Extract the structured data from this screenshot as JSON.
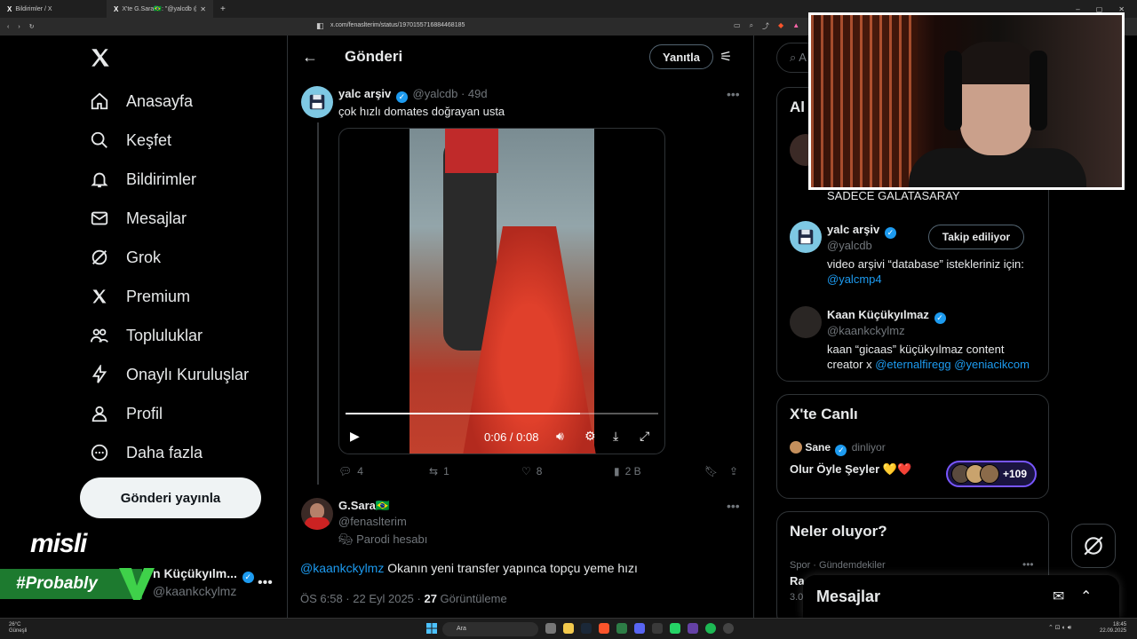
{
  "browser": {
    "tabs": [
      {
        "label": "Bildirimler / X"
      },
      {
        "label": "X'te G.Sara🇧🇷: \"@yalcdb @k..."
      }
    ],
    "url": "x.com/fenaslterim/status/1970155716884468185"
  },
  "nav": {
    "items": [
      {
        "label": "Anasayfa",
        "icon": "home-icon"
      },
      {
        "label": "Keşfet",
        "icon": "search-icon"
      },
      {
        "label": "Bildirimler",
        "icon": "bell-icon"
      },
      {
        "label": "Mesajlar",
        "icon": "mail-icon"
      },
      {
        "label": "Grok",
        "icon": "grok-icon"
      },
      {
        "label": "Premium",
        "icon": "x-icon"
      },
      {
        "label": "Topluluklar",
        "icon": "people-icon"
      },
      {
        "label": "Onaylı Kuruluşlar",
        "icon": "lightning-icon"
      },
      {
        "label": "Profil",
        "icon": "person-icon"
      },
      {
        "label": "Daha fazla",
        "icon": "more-circle-icon"
      }
    ],
    "post_button": "Gönderi yayınla",
    "account": {
      "name": "Kaan Küçükyılm...",
      "handle": "@kaankckylmz",
      "name_visible": "n Küçükyılm..."
    }
  },
  "overlay": {
    "misli": "misli",
    "probably": "#Probably"
  },
  "main": {
    "title": "Gönderi",
    "reply_button": "Yanıtla",
    "post": {
      "name": "yalc arşiv",
      "handle": "@yalcdb",
      "age": "49d",
      "text": "çok hızlı domates doğrayan usta",
      "video_time": "0:06 / 0:08",
      "progress_fraction": 0.75,
      "stats": {
        "replies": "4",
        "reposts": "1",
        "likes": "8",
        "views": "2 B"
      }
    },
    "reply": {
      "name": "G.Sara🇧🇷",
      "handle": "@fenaslterim",
      "badge": "Parodi hesabı",
      "mention": "@kaankckylmz",
      "text": " Okanın yeni transfer yapınca topçu yeme hızı",
      "time": "ÖS 6:58 · 22 Eyl 2025 · ",
      "views": "27",
      "views_label": " Görüntüleme"
    }
  },
  "right": {
    "search_placeholder": "A",
    "relevant": {
      "title": "Al",
      "first_bio_tail": "SADECE GALATASARAY",
      "users": [
        {
          "name": "yalc arşiv",
          "handle": "@yalcdb",
          "bio": "video arşivi “database” istekleriniz için: ",
          "bio_link": "@yalcmp4",
          "button": "Takip ediliyor"
        },
        {
          "name": "Kaan Küçükyılmaz",
          "handle": "@kaankckylmz",
          "bio": "kaan “gicaas” küçükyılmaz content creator x ",
          "bio_link": "@eternalfiregg @yeniacikcom"
        }
      ]
    },
    "live": {
      "title": "X'te Canlı",
      "host": "Sane",
      "host_status": " dinliyor",
      "space_title": "Olur Öyle Şeyler 💛❤️",
      "listeners": "+109"
    },
    "trends": {
      "title": "Neler oluyor?",
      "category": "Spor · Gündemdekiler",
      "name": "Ra",
      "count": "3.0"
    },
    "messages_drawer": "Mesajlar"
  },
  "taskbar": {
    "temp": "26°C",
    "weather": "Güneşli",
    "search": "Ara",
    "time": "18:45",
    "date": "22.09.2025"
  },
  "colors": {
    "accent": "#1d9bf0",
    "overlay_green": "#1d7a2f",
    "space_purple": "#7856ff"
  }
}
